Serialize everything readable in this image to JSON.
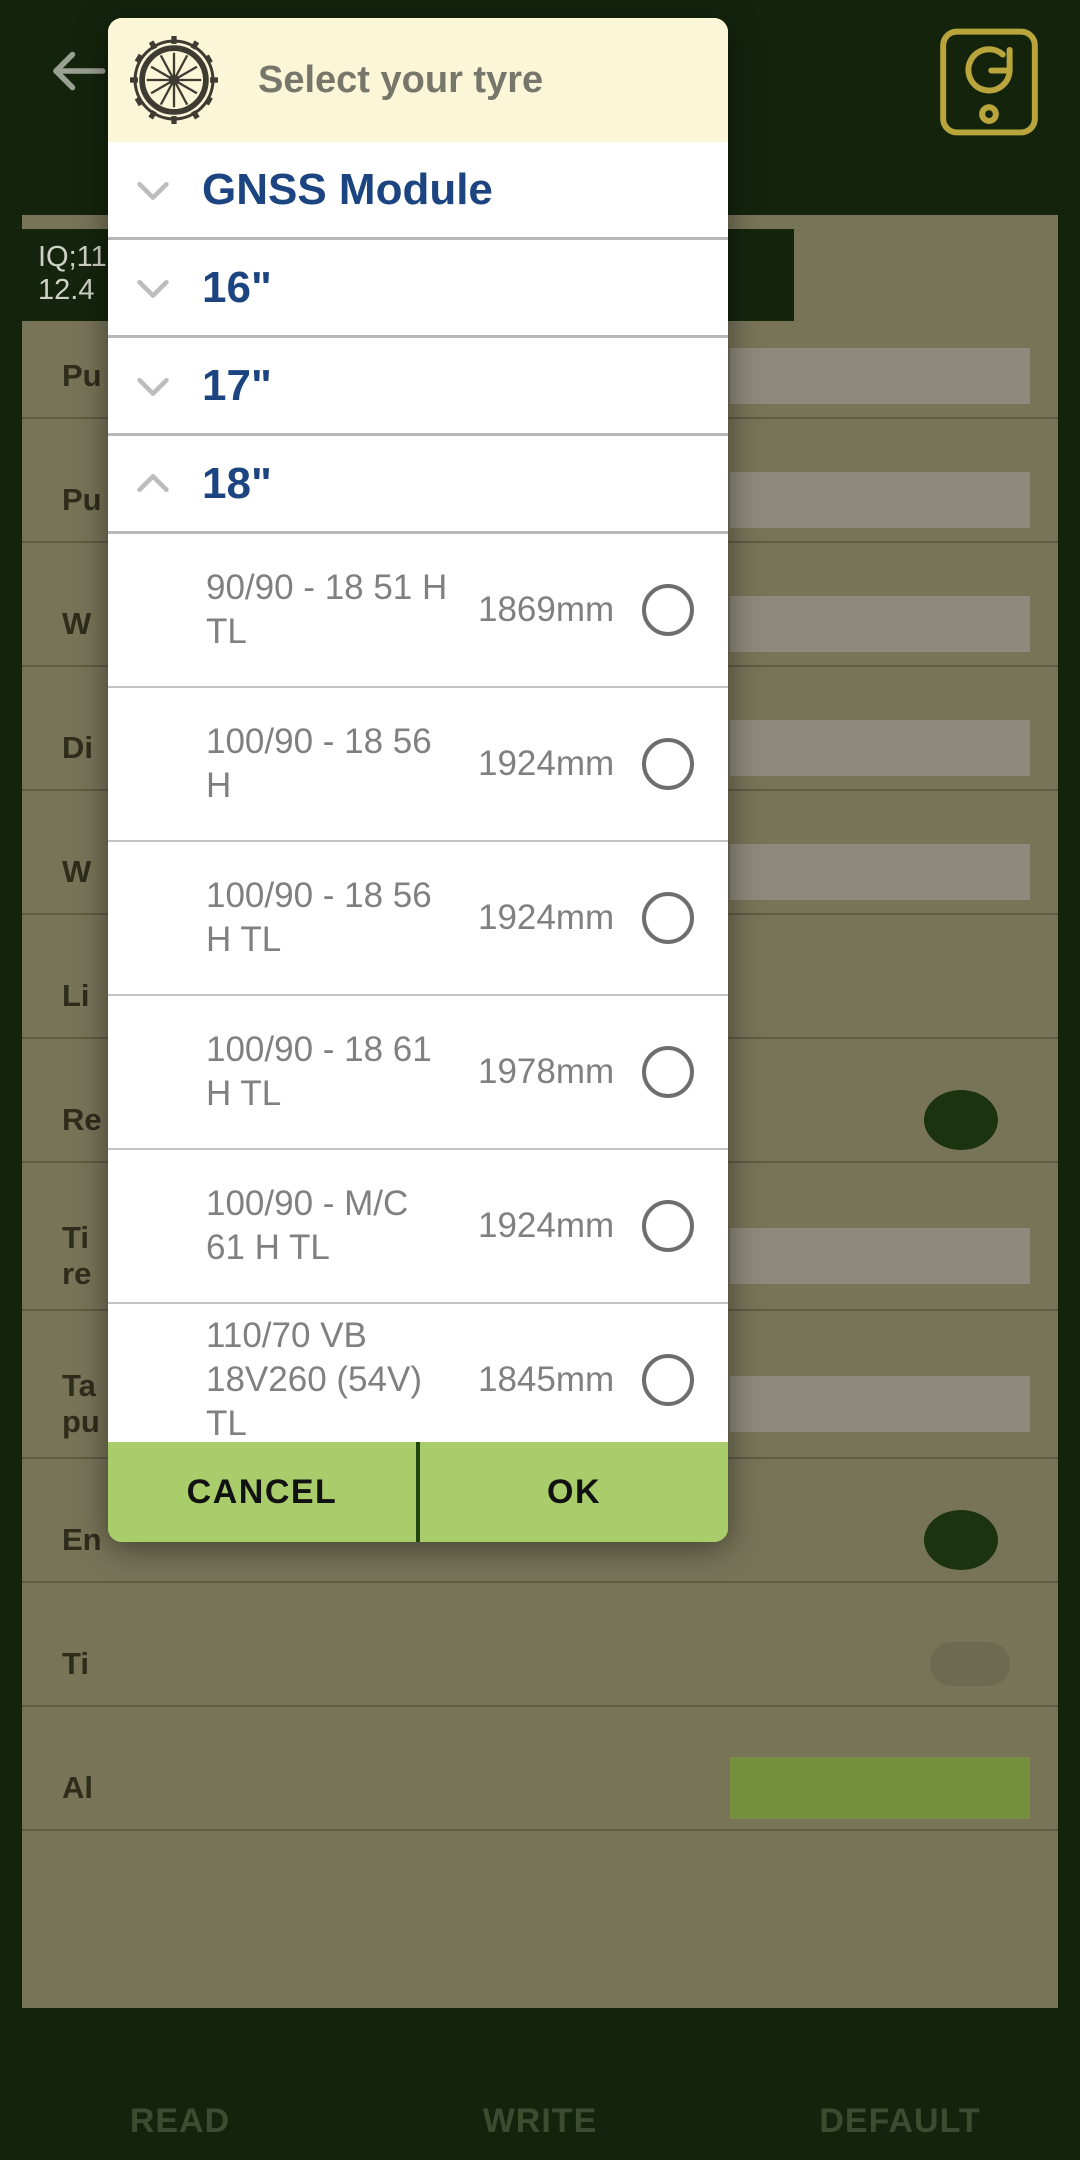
{
  "background": {
    "appbar": {
      "back_icon": "arrow-left-icon",
      "save_icon": "save-refresh-icon"
    },
    "status_chip": "IQ;11\n12.4",
    "rows": [
      {
        "label": "Pu",
        "control": "field"
      },
      {
        "label": "Pu",
        "control": "field"
      },
      {
        "label": "W",
        "control": "field"
      },
      {
        "label": "Di",
        "control": "field"
      },
      {
        "label": "W",
        "control": "field"
      },
      {
        "label": "Li",
        "control": "none"
      },
      {
        "label": "Re",
        "control": "dot"
      },
      {
        "label": "Ti\nre",
        "control": "field"
      },
      {
        "label": "Ta\npu",
        "control": "field"
      },
      {
        "label": "En",
        "control": "dot"
      },
      {
        "label": "Ti",
        "control": "toggle"
      },
      {
        "label": "Al",
        "control": "green"
      }
    ],
    "bottom_buttons": [
      "READ",
      "WRITE",
      "DEFAULT"
    ]
  },
  "dialog": {
    "icon": "tyre-icon",
    "title": "Select your tyre",
    "groups": [
      {
        "label": "GNSS Module",
        "expanded": false,
        "chevron": "chevron-down-icon"
      },
      {
        "label": "16\"",
        "expanded": false,
        "chevron": "chevron-down-icon"
      },
      {
        "label": "17\"",
        "expanded": false,
        "chevron": "chevron-down-icon"
      },
      {
        "label": "18\"",
        "expanded": true,
        "chevron": "chevron-up-icon"
      }
    ],
    "tyres": [
      {
        "name": "90/90 - 18 51 H TL",
        "circumference": "1869mm",
        "selected": false
      },
      {
        "name": "100/90 - 18 56 H",
        "circumference": "1924mm",
        "selected": false
      },
      {
        "name": "100/90 - 18 56 H TL",
        "circumference": "1924mm",
        "selected": false
      },
      {
        "name": "100/90 - 18 61 H TL",
        "circumference": "1978mm",
        "selected": false
      },
      {
        "name": "100/90 - M/C 61 H TL",
        "circumference": "1924mm",
        "selected": false
      },
      {
        "name": "110/70 VB 18V260 (54V) TL",
        "circumference": "1845mm",
        "selected": false
      }
    ],
    "actions": {
      "cancel_label": "CANCEL",
      "ok_label": "OK"
    }
  },
  "colors": {
    "dialog_header_bg": "#faf6d7",
    "group_label": "#1b4480",
    "action_bar": "#a9cd6a",
    "app_background": "#14240c",
    "panel": "#777458"
  }
}
